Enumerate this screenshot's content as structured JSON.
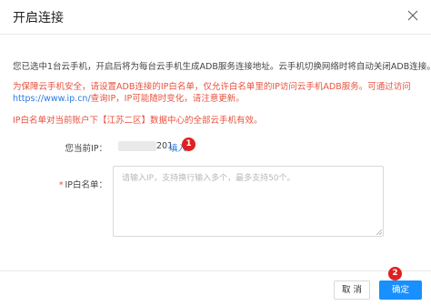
{
  "dialog": {
    "title": "开启连接",
    "info": "您已选中1台云手机，开启后将为每台云手机生成ADB服务连接地址。云手机切换网络时将自动关闭ADB连接。",
    "warn_line1": "为保障云手机安全，请设置ADB连接的IP白名单，仅允许白名单里的IP访问云手机ADB服务。可通过访问",
    "warn_link": "https://www.ip.cn/",
    "warn_line2_rest": "查询IP，IP可能随时变化，请注意更新。",
    "notice": "IP白名单对当前账户下【江苏二区】数据中心的全部云手机有效。"
  },
  "current_ip": {
    "label": "您当前IP：",
    "value_suffix": "201",
    "fill_link": "填入"
  },
  "whitelist": {
    "required_mark": "*",
    "label": "IP白名单：",
    "placeholder": "请输入IP，支持换行输入多个，最多支持50个。",
    "value": ""
  },
  "badges": {
    "one": "1",
    "two": "2",
    "color": "#e02020"
  },
  "footer": {
    "cancel_label": "取 消",
    "ok_label": "确定"
  },
  "colors": {
    "primary": "#1890ff",
    "warning": "#e8523f",
    "link": "#2a7ae2"
  }
}
